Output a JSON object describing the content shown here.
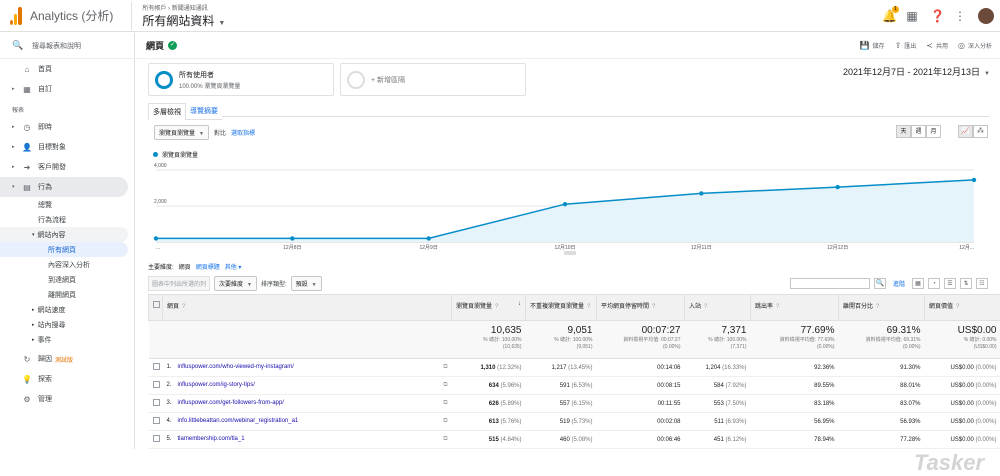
{
  "header": {
    "app_name": "Analytics (分析)",
    "breadcrumb": "所有帳戶 › 新聞通知通訊",
    "property": "所有網站資料",
    "notification_count": "1",
    "icons": [
      "bell-icon",
      "apps-grid-icon",
      "help-icon",
      "more-vert-icon",
      "avatar"
    ]
  },
  "sidebar": {
    "search_placeholder": "搜尋報表和說明",
    "items_top": [
      {
        "label": "首頁",
        "icon": "home-icon"
      },
      {
        "label": "自訂",
        "icon": "grid-icon"
      }
    ],
    "section_label": "報表",
    "items_reports": [
      {
        "label": "即時",
        "icon": "clock-icon"
      },
      {
        "label": "目標對象",
        "icon": "person-icon"
      },
      {
        "label": "客戶開發",
        "icon": "acquisition-icon"
      },
      {
        "label": "行為",
        "icon": "behavior-icon"
      }
    ],
    "behavior_sub": [
      "總覽",
      "行為流程"
    ],
    "site_content": "網站內容",
    "site_content_sub": [
      "所有網頁",
      "內容深入分析",
      "到達網頁",
      "離開網頁"
    ],
    "behavior_more": [
      "網站速度",
      "站內搜尋",
      "事件"
    ],
    "items_bottom": [
      {
        "label": "歸因",
        "icon": "attribution-icon",
        "beta": "測試版"
      },
      {
        "label": "探索",
        "icon": "lightbulb-icon"
      },
      {
        "label": "管理",
        "icon": "gear-icon"
      }
    ]
  },
  "page": {
    "title": "網頁",
    "actions": [
      {
        "label": "儲存",
        "icon": "save-icon"
      },
      {
        "label": "匯出",
        "icon": "export-icon"
      },
      {
        "label": "共用",
        "icon": "share-icon"
      },
      {
        "label": "深入分析",
        "icon": "insights-icon"
      }
    ],
    "segment_1_name": "所有使用者",
    "segment_1_desc": "100.00% 瀏覽頁瀏覽量",
    "segment_add": "+ 新增區隔",
    "date_range": "2021年12月7日 - 2021年12月13日",
    "tabs": [
      "多層檢視",
      "導覽摘要"
    ]
  },
  "chart_controls": {
    "metric": "瀏覽頁瀏覽量",
    "compare_label": "對比",
    "select_metric": "選取指標",
    "granularity": [
      "天",
      "週",
      "月"
    ],
    "legend": "瀏覽頁瀏覽量"
  },
  "chart_data": {
    "type": "area",
    "x": [
      "2021-12-07",
      "2021-12-08",
      "2021-12-09",
      "2021-12-10",
      "2021-12-11",
      "2021-12-12",
      "2021-12-13"
    ],
    "tick_labels": [
      "...",
      "12月8日",
      "12月9日",
      "12月10日",
      "12月11日",
      "12月12日",
      "12月..."
    ],
    "series": [
      {
        "name": "瀏覽頁瀏覽量",
        "values": [
          200,
          200,
          200,
          2100,
          2700,
          3050,
          3450
        ],
        "color": "#058dc7"
      }
    ],
    "y_ticks": [
      "2,000",
      "4,000"
    ],
    "ylim": [
      0,
      4000
    ],
    "grid": true
  },
  "table_controls": {
    "primary_dim_label": "主要維度:",
    "dims": [
      "網頁",
      "網頁標題",
      "其他"
    ],
    "plot_rows": "圖表中列出所選的列",
    "secondary_dim": "次要維度",
    "sort_type_label": "排序類型:",
    "sort_type": "預設",
    "advanced": "進階"
  },
  "table": {
    "columns": [
      "網頁",
      "瀏覽頁瀏覽量",
      "不重複瀏覽頁瀏覽量",
      "平均網頁停留時間",
      "入站",
      "跳出率",
      "離開百分比",
      "網頁價值"
    ],
    "totals": [
      {
        "main": "10,635",
        "sub1": "% 總計: 100.00%",
        "sub2": "(10,635)"
      },
      {
        "main": "9,051",
        "sub1": "% 總計: 100.00%",
        "sub2": "(9,051)"
      },
      {
        "main": "00:07:27",
        "sub1": "資料檢視平均值: 00:07:27",
        "sub2": "(0.00%)"
      },
      {
        "main": "7,371",
        "sub1": "% 總計: 100.00%",
        "sub2": "(7,371)"
      },
      {
        "main": "77.69%",
        "sub1": "資料檢視平均值: 77.69%",
        "sub2": "(0.00%)"
      },
      {
        "main": "69.31%",
        "sub1": "資料檢視平均值: 69.31%",
        "sub2": "(0.00%)"
      },
      {
        "main": "US$0.00",
        "sub1": "% 總計: 0.00%",
        "sub2": "(US$0.00)"
      }
    ],
    "rows": [
      {
        "idx": "1.",
        "page": "influspower.com/who-viewed-my-instagram/",
        "pv": "1,310",
        "pv_pct": "(12.32%)",
        "upv": "1,217",
        "upv_pct": "(13.45%)",
        "time": "00:14:06",
        "ent": "1,204",
        "ent_pct": "(16.33%)",
        "bounce": "92.36%",
        "exit": "91.30%",
        "val": "US$0.00",
        "val_pct": "(0.00%)"
      },
      {
        "idx": "2.",
        "page": "influspower.com/ig-story-tips/",
        "pv": "634",
        "pv_pct": "(5.96%)",
        "upv": "591",
        "upv_pct": "(6.53%)",
        "time": "00:08:15",
        "ent": "584",
        "ent_pct": "(7.92%)",
        "bounce": "89.55%",
        "exit": "88.01%",
        "val": "US$0.00",
        "val_pct": "(0.00%)"
      },
      {
        "idx": "3.",
        "page": "influspower.com/get-followers-from-app/",
        "pv": "626",
        "pv_pct": "(5.89%)",
        "upv": "557",
        "upv_pct": "(6.15%)",
        "time": "00:11:55",
        "ent": "553",
        "ent_pct": "(7.50%)",
        "bounce": "83.18%",
        "exit": "83.07%",
        "val": "US$0.00",
        "val_pct": "(0.00%)"
      },
      {
        "idx": "4.",
        "page": "info.littlebeattan.com/webinar_registration_a1",
        "pv": "613",
        "pv_pct": "(5.76%)",
        "upv": "519",
        "upv_pct": "(5.73%)",
        "time": "00:02:08",
        "ent": "511",
        "ent_pct": "(6.93%)",
        "bounce": "56.95%",
        "exit": "56.93%",
        "val": "US$0.00",
        "val_pct": "(0.00%)"
      },
      {
        "idx": "5.",
        "page": "tlamembership.com/tla_1",
        "pv": "515",
        "pv_pct": "(4.84%)",
        "upv": "460",
        "upv_pct": "(5.08%)",
        "time": "00:06:46",
        "ent": "451",
        "ent_pct": "(6.12%)",
        "bounce": "78.94%",
        "exit": "77.28%",
        "val": "US$0.00",
        "val_pct": "(0.00%)"
      }
    ]
  },
  "watermark": "Tasker"
}
